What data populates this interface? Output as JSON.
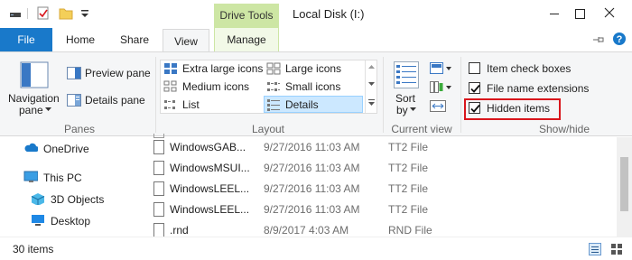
{
  "window": {
    "title": "Local Disk (I:)",
    "contextual_tab": "Drive Tools"
  },
  "tabs": {
    "file": "File",
    "home": "Home",
    "share": "Share",
    "view": "View",
    "manage": "Manage"
  },
  "ribbon": {
    "panes": {
      "group_label": "Panes",
      "navigation_pane": "Navigation",
      "navigation_pane_line2": "pane",
      "preview_pane": "Preview pane",
      "details_pane": "Details pane"
    },
    "layout": {
      "group_label": "Layout",
      "extra_large_icons": "Extra large icons",
      "large_icons": "Large icons",
      "medium_icons": "Medium icons",
      "small_icons": "Small icons",
      "list": "List",
      "details": "Details"
    },
    "current_view": {
      "group_label": "Current view",
      "sort_by": "Sort",
      "sort_by_line2": "by"
    },
    "show_hide": {
      "group_label": "Show/hide",
      "item_check_boxes": "Item check boxes",
      "item_check_boxes_checked": false,
      "file_name_extensions": "File name extensions",
      "file_name_extensions_checked": true,
      "hidden_items": "Hidden items",
      "hidden_items_checked": true
    }
  },
  "nav_pane": {
    "items": [
      {
        "label": "OneDrive",
        "icon": "cloud-icon"
      },
      {
        "label": "This PC",
        "icon": "computer-icon"
      },
      {
        "label": "3D Objects",
        "icon": "cube-icon"
      },
      {
        "label": "Desktop",
        "icon": "desktop-icon"
      }
    ]
  },
  "files": [
    {
      "name": "WindowsGAB...",
      "date": "9/27/2016 11:03 AM",
      "type": "TT2 File"
    },
    {
      "name": "WindowsMSUI...",
      "date": "9/27/2016 11:03 AM",
      "type": "TT2 File"
    },
    {
      "name": "WindowsLEEL...",
      "date": "9/27/2016 11:03 AM",
      "type": "TT2 File"
    },
    {
      "name": "WindowsLEEL...",
      "date": "9/27/2016 11:03 AM",
      "type": "TT2 File"
    },
    {
      "name": ".rnd",
      "date": "8/9/2017 4:03 AM",
      "type": "RND File"
    }
  ],
  "status": {
    "item_count": "30 items"
  },
  "colors": {
    "file_tab": "#1979ca",
    "drive_tools_tab": "#cde6a4",
    "selection": "#cce8ff",
    "highlight_box": "#d9161c",
    "help_icon": "#1979ca"
  }
}
